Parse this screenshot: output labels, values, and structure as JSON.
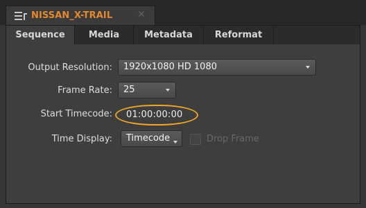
{
  "sequence_tab": {
    "title": "NISSAN_X-TRAIL",
    "close_glyph": "✕",
    "icon": "sequence-icon",
    "accent_color": "#e4892d"
  },
  "tabs": [
    {
      "label": "Sequence",
      "active": true
    },
    {
      "label": "Media",
      "active": false
    },
    {
      "label": "Metadata",
      "active": false
    },
    {
      "label": "Reformat",
      "active": false
    }
  ],
  "settings": {
    "output_resolution": {
      "label": "Output Resolution:",
      "value": "1920x1080 HD 1080"
    },
    "frame_rate": {
      "label": "Frame Rate:",
      "value": "25"
    },
    "start_timecode": {
      "label": "Start Timecode:",
      "value": "01:00:00:00"
    },
    "time_display": {
      "label": "Time Display:",
      "value": "Timecode"
    },
    "drop_frame": {
      "label": "Drop Frame",
      "checked": false,
      "enabled": false
    }
  },
  "highlight_color": "#f0a526"
}
